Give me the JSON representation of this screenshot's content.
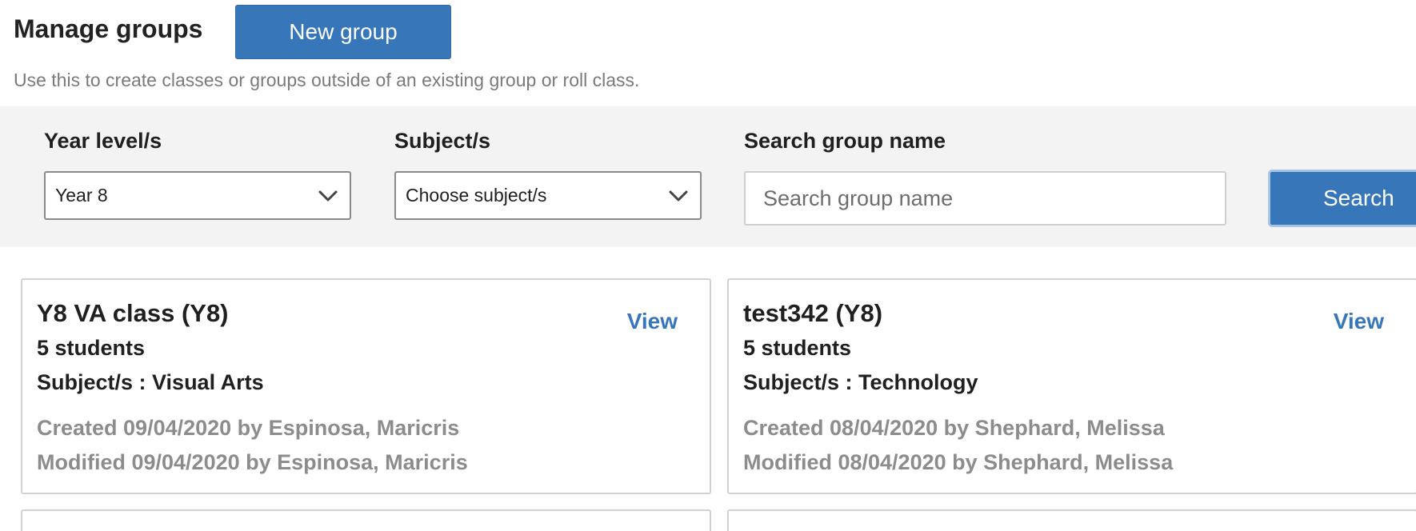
{
  "header": {
    "title": "Manage groups",
    "new_group_label": "New group",
    "subtitle": "Use this to create classes or groups outside of an existing group or roll class."
  },
  "filters": {
    "year_label": "Year level/s",
    "year_value": "Year 8",
    "subject_label": "Subject/s",
    "subject_value": "Choose subject/s",
    "search_label": "Search group name",
    "search_placeholder": "Search group name",
    "search_button": "Search"
  },
  "groups": [
    {
      "name": "Y8 VA class (Y8)",
      "students": "5 students",
      "subjects": "Subject/s : Visual Arts",
      "created": "Created 09/04/2020 by Espinosa, Maricris",
      "modified": "Modified 09/04/2020 by Espinosa, Maricris",
      "view_label": "View"
    },
    {
      "name": "test342 (Y8)",
      "students": "5 students",
      "subjects": "Subject/s : Technology",
      "created": "Created 08/04/2020 by Shephard, Melissa",
      "modified": "Modified 08/04/2020 by Shephard, Melissa",
      "view_label": "View"
    }
  ],
  "colors": {
    "primary": "#3776b8",
    "filter_background": "#f3f3f3",
    "muted_text": "#8c8c8c"
  },
  "icons": {
    "dropdown": "chevron-down-icon"
  }
}
